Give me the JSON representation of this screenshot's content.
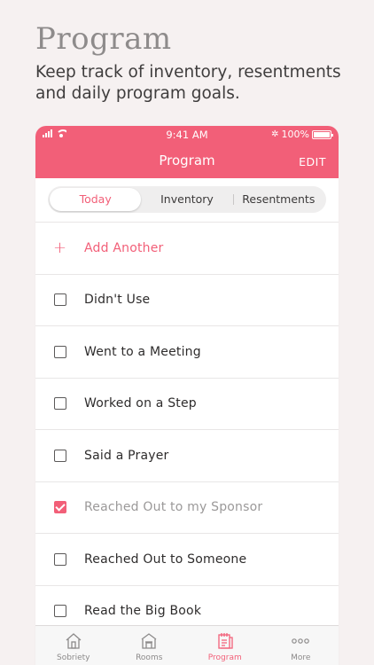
{
  "promo": {
    "title": "Program",
    "subtitle": "Keep track of inventory, resentments and daily program goals."
  },
  "status_bar": {
    "time": "9:41 AM",
    "battery": "100%"
  },
  "nav": {
    "title": "Program",
    "edit_label": "EDIT"
  },
  "segments": [
    {
      "label": "Today",
      "active": true
    },
    {
      "label": "Inventory",
      "active": false
    },
    {
      "label": "Resentments",
      "active": false
    }
  ],
  "add_row": {
    "label": "Add Another"
  },
  "items": [
    {
      "label": "Didn't Use",
      "checked": false
    },
    {
      "label": "Went to a Meeting",
      "checked": false
    },
    {
      "label": "Worked on a Step",
      "checked": false
    },
    {
      "label": "Said a Prayer",
      "checked": false
    },
    {
      "label": "Reached Out to my Sponsor",
      "checked": true
    },
    {
      "label": "Reached Out to Someone",
      "checked": false
    },
    {
      "label": "Read the Big Book",
      "checked": false
    }
  ],
  "tabs": [
    {
      "label": "Sobriety",
      "icon": "house-icon",
      "active": false
    },
    {
      "label": "Rooms",
      "icon": "building-icon",
      "active": false
    },
    {
      "label": "Program",
      "icon": "notebook-icon",
      "active": true
    },
    {
      "label": "More",
      "icon": "more-icon",
      "active": false
    }
  ],
  "colors": {
    "accent": "#f25f78",
    "background": "#f6f1f1"
  }
}
